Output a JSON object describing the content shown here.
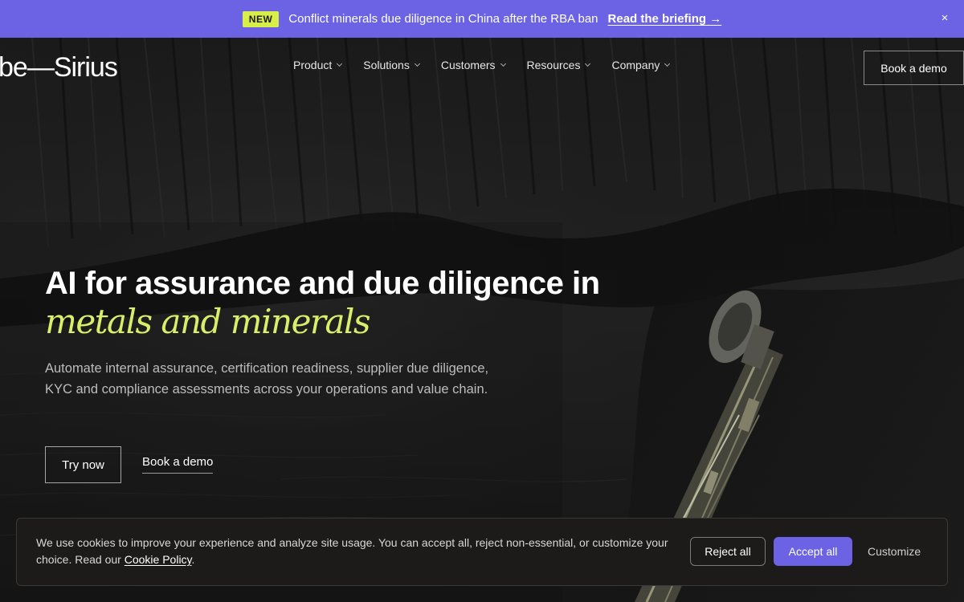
{
  "announcement": {
    "badge": "NEW",
    "text": "Conflict minerals due diligence in China after the RBA ban",
    "link": "Read the briefing →",
    "close_icon": "×",
    "background": "#6b63e4",
    "badge_color": "#d8ef4a"
  },
  "header": {
    "logo": "be—Sirius",
    "nav": [
      "Product",
      "Solutions",
      "Customers",
      "Resources",
      "Company"
    ],
    "cta": "Book a demo"
  },
  "hero": {
    "headline": "AI for assurance and due diligence in",
    "headline_accent": "metals and minerals",
    "accent_color": "#d9ef6a",
    "subcopy": "Automate internal assurance, certification readiness, supplier due diligence, KYC and compliance assessments across your operations and value chain.",
    "primary_button": "Try now",
    "secondary_link": "Book a demo"
  },
  "cookie_banner": {
    "text": "We use cookies to improve your experience and analyze site usage. You can accept all, reject non-essential, or customize your choice. Read our",
    "policy_link": "Cookie Policy",
    "period": ".",
    "reject": "Reject all",
    "accept": "Accept all",
    "customize": "Customize"
  }
}
